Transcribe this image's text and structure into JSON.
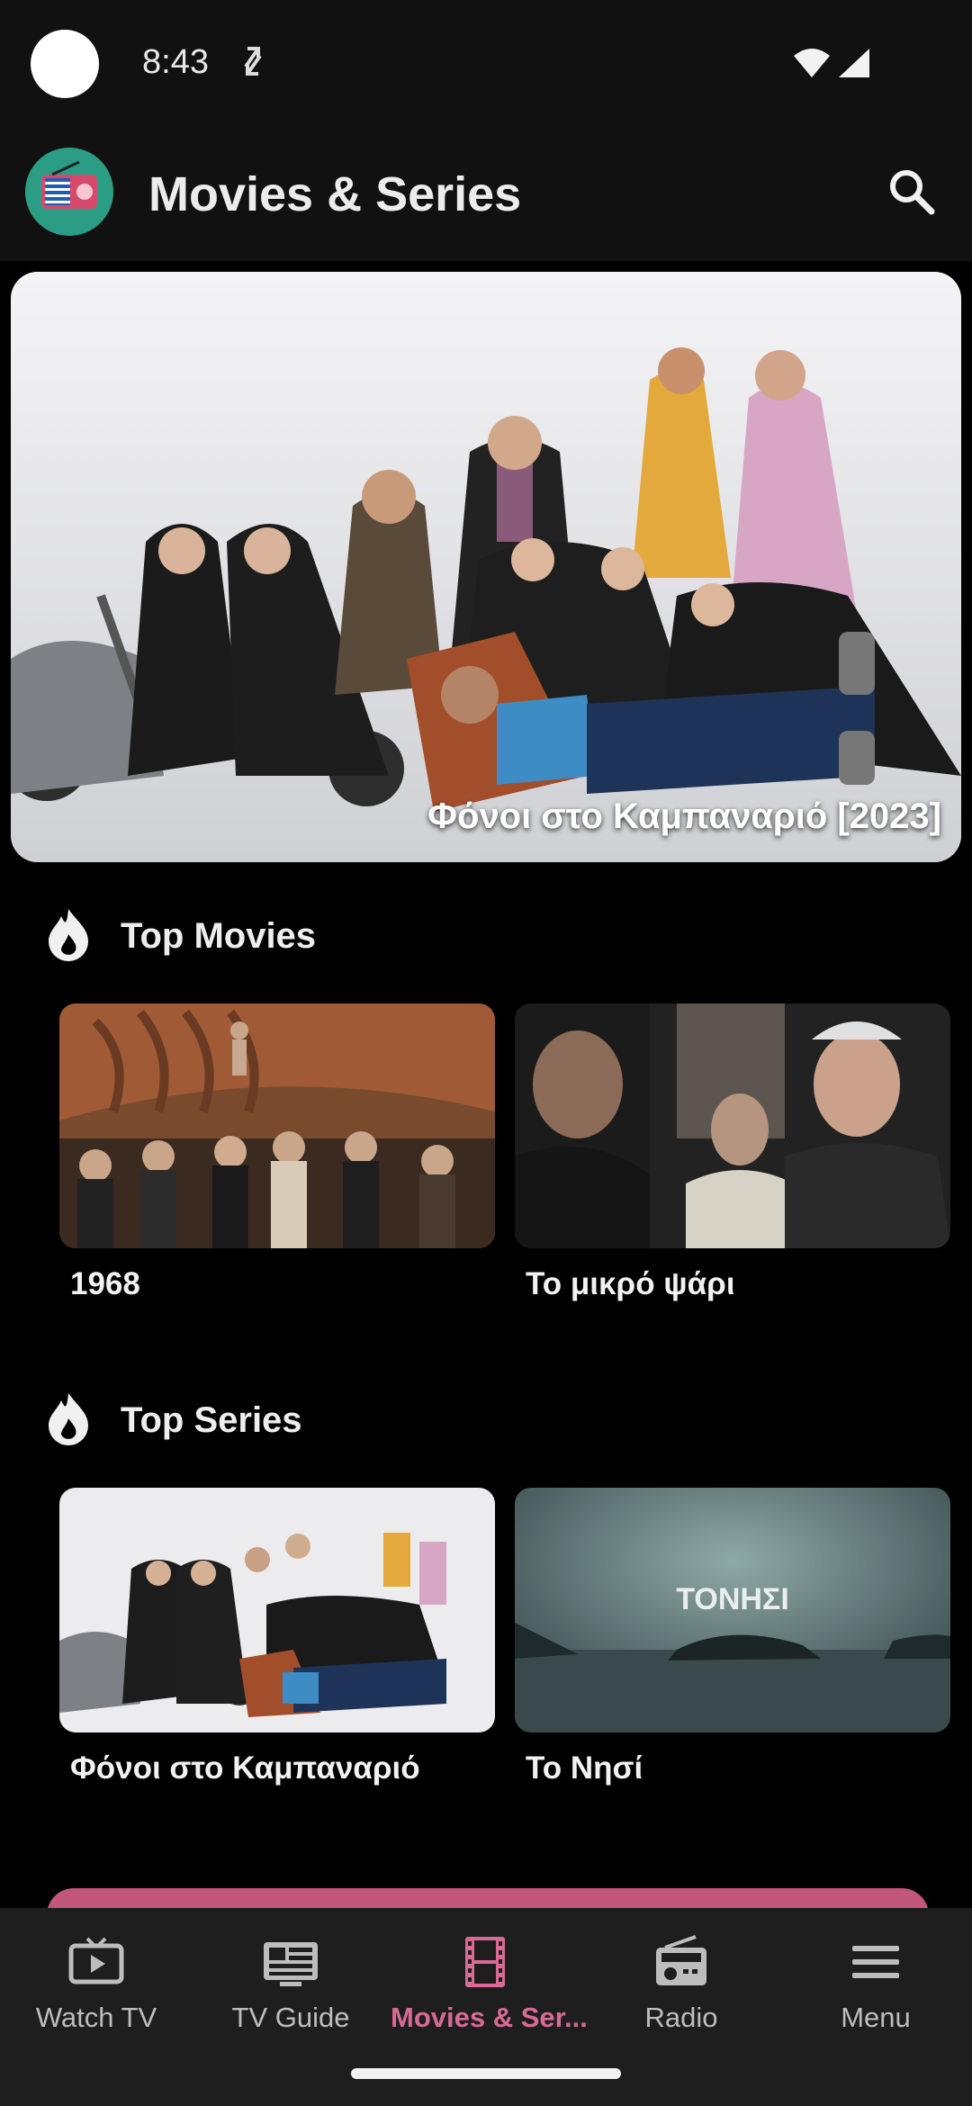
{
  "status_bar": {
    "time": "8:43"
  },
  "app_bar": {
    "title": "Movies & Series"
  },
  "hero": {
    "title": "Φόνοι στο Καμπαναριό [2023]"
  },
  "top_movies": {
    "title": "Top Movies",
    "items": [
      {
        "title": "1968"
      },
      {
        "title": "Το μικρό ψάρι"
      }
    ]
  },
  "top_series": {
    "title": "Top Series",
    "items": [
      {
        "title": "Φόνοι στο Καμπαναριό"
      },
      {
        "title": "Το Νησί",
        "poster_text": "ΤΟΝΗΣΙ"
      }
    ]
  },
  "bottom_nav": {
    "items": [
      {
        "label": "Watch TV",
        "icon": "tv-play-icon"
      },
      {
        "label": "TV Guide",
        "icon": "tv-guide-icon"
      },
      {
        "label": "Movies & Ser...",
        "icon": "film-icon",
        "active": true
      },
      {
        "label": "Radio",
        "icon": "radio-icon"
      },
      {
        "label": "Menu",
        "icon": "menu-icon"
      }
    ]
  },
  "colors": {
    "accent": "#d86a95",
    "background": "#000000",
    "bar": "#111111",
    "nav": "#1e1e1e"
  }
}
